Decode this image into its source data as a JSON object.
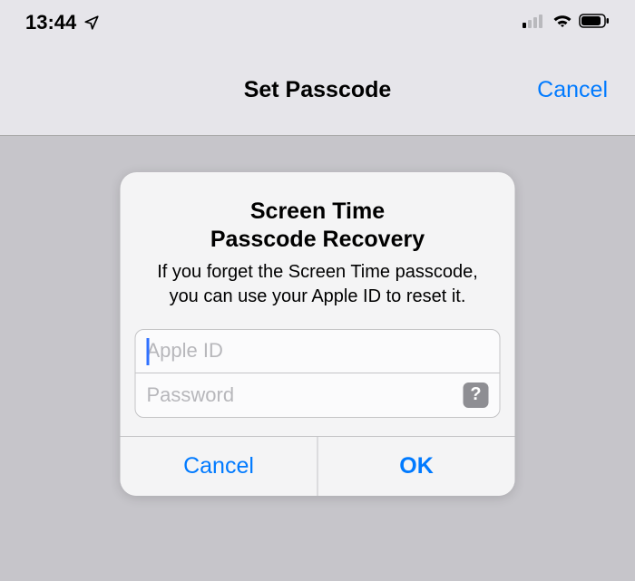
{
  "statusBar": {
    "time": "13:44"
  },
  "navBar": {
    "title": "Set Passcode",
    "cancel": "Cancel"
  },
  "alert": {
    "titleLine1": "Screen Time",
    "titleLine2": "Passcode Recovery",
    "message": "If you forget the Screen Time passcode, you can use your Apple ID to reset it.",
    "appleIdPlaceholder": "Apple ID",
    "appleIdValue": "",
    "passwordPlaceholder": "Password",
    "passwordValue": "",
    "helpLabel": "?",
    "cancel": "Cancel",
    "ok": "OK"
  }
}
